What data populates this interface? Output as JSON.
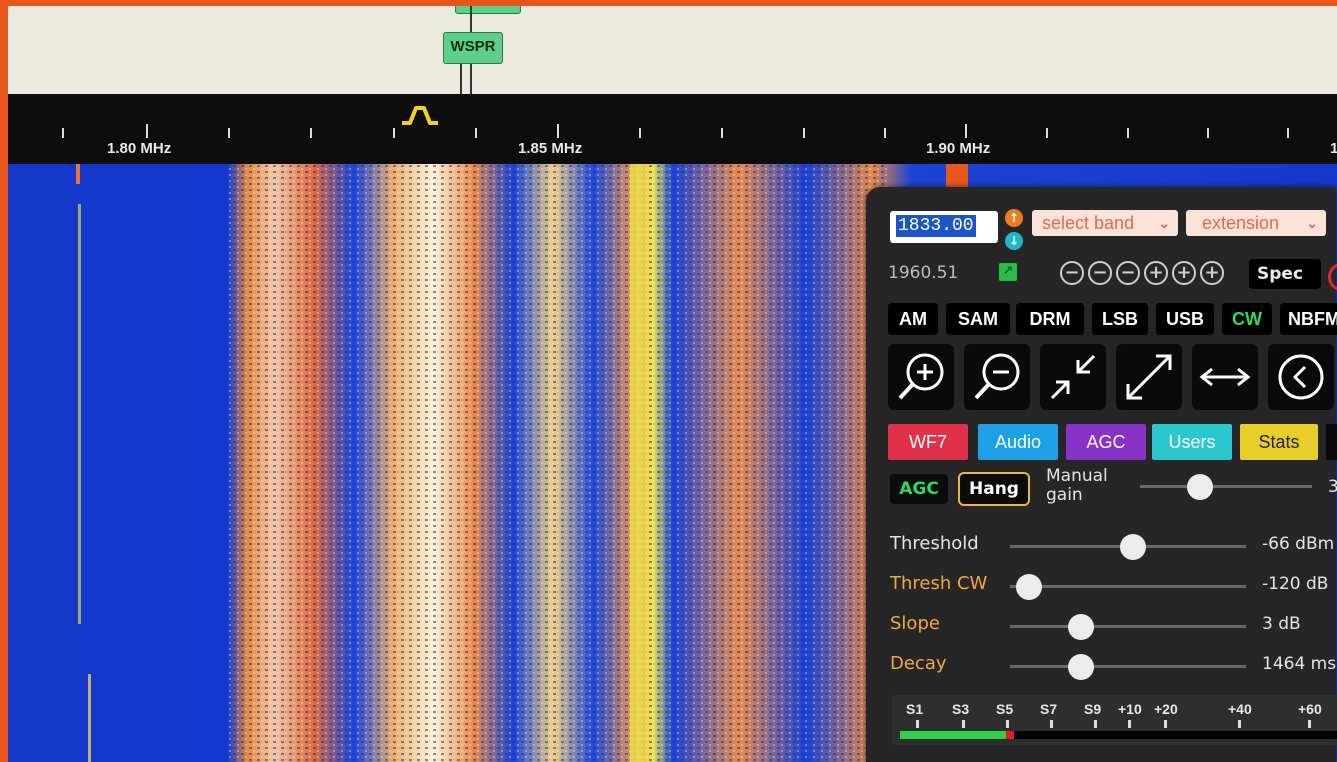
{
  "band_bar": {
    "tag_label": "WSPR"
  },
  "scale": {
    "labels": [
      "1.80 MHz",
      "1.85 MHz",
      "1.90 MHz"
    ],
    "edge_label": "1"
  },
  "panel": {
    "frequency_value": "1833.00",
    "select_band_label": "select band",
    "extension_label": "extension",
    "step_value": "1960.51",
    "zoom_controls": [
      "−",
      "−",
      "−",
      "+",
      "+",
      "+"
    ],
    "spec_label": "Spec",
    "modes": [
      "AM",
      "SAM",
      "DRM",
      "LSB",
      "USB",
      "CW",
      "NBFM"
    ],
    "active_mode": "CW",
    "tabs": [
      {
        "label": "WF7",
        "color": "#e0314a"
      },
      {
        "label": "Audio",
        "color": "#1da0e6"
      },
      {
        "label": "AGC",
        "color": "#8833c6"
      },
      {
        "label": "Users",
        "color": "#2bc6cf"
      },
      {
        "label": "Stats",
        "color": "#e7cf2a"
      }
    ],
    "agc": {
      "agc_label": "AGC",
      "hang_label": "Hang",
      "manual_gain_label": "Manual gain",
      "manual_gain_value": "3",
      "manual_gain_level": 0.35,
      "sliders": [
        {
          "label": "Threshold",
          "value": "-66 dBm",
          "level": 0.52,
          "label_color": "#e5e5e5"
        },
        {
          "label": "Thresh CW",
          "value": "-120 dB",
          "level": 0.08,
          "label_color": "#f2a845"
        },
        {
          "label": "Slope",
          "value": "3 dB",
          "level": 0.3,
          "label_color": "#f2a845"
        },
        {
          "label": "Decay",
          "value": "1464 ms",
          "level": 0.3,
          "label_color": "#f2a845"
        }
      ]
    },
    "smeter": {
      "labels": [
        "S1",
        "S3",
        "S5",
        "S7",
        "S9",
        "+10",
        "+20",
        "+40",
        "+60"
      ],
      "level": 0.24
    }
  },
  "colors": {
    "accent_orange": "#e8561c",
    "waterfall_blue": "#1136c8"
  }
}
